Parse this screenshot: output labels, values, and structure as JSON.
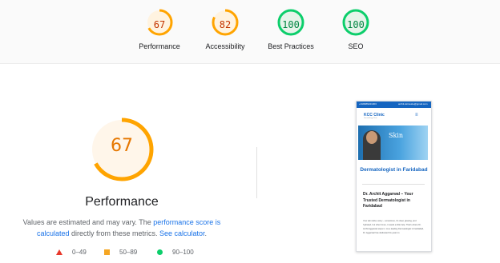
{
  "summary": {
    "categories": [
      {
        "score": "67",
        "label": "Performance",
        "ring_color": "#ffa400",
        "text_color": "#c33300",
        "fill": "#fff3e0",
        "fraction": 0.67
      },
      {
        "score": "82",
        "label": "Accessibility",
        "ring_color": "#ffa400",
        "text_color": "#c33300",
        "fill": "#fff3e0",
        "fraction": 0.82
      },
      {
        "score": "100",
        "label": "Best Practices",
        "ring_color": "#0cce6b",
        "text_color": "#018642",
        "fill": "#e6f4ea",
        "fraction": 1.0
      },
      {
        "score": "100",
        "label": "SEO",
        "ring_color": "#0cce6b",
        "text_color": "#018642",
        "fill": "#e6f4ea",
        "fraction": 1.0
      }
    ]
  },
  "performance": {
    "score": "67",
    "fraction": 0.67,
    "label": "Performance",
    "ring_color": "#ffa400",
    "description_prefix": "Values are estimated and may vary. The ",
    "score_link": "performance score is calculated",
    "description_middle": " directly from these metrics. ",
    "calculator_link": "See calculator",
    "description_end": "."
  },
  "legend": {
    "fail": "0–49",
    "average": "50–89",
    "pass": "90–100"
  },
  "screenshot": {
    "top_left": "+918486241303",
    "top_right": "archit.skinsuite@gmail.com",
    "logo": "KCC Clinic",
    "logo_sub": "Dermatology Clinic",
    "menu_icon": "≡",
    "hero_text": "Skin",
    "title": "Dermatologist in Faridabad",
    "heading": "Dr. Archit Aggarwal – Your Trusted Dermatologist in Faridabad",
    "body": "Your skin tells a story – sometimes, it's clear, glowing, and hydrated, but other times, it needs a little help. That's where Dr. Archit Aggarwal steps in. As a leading Dermatologist in Faridabad, Dr. Aggarwal has dedicated his years to"
  }
}
